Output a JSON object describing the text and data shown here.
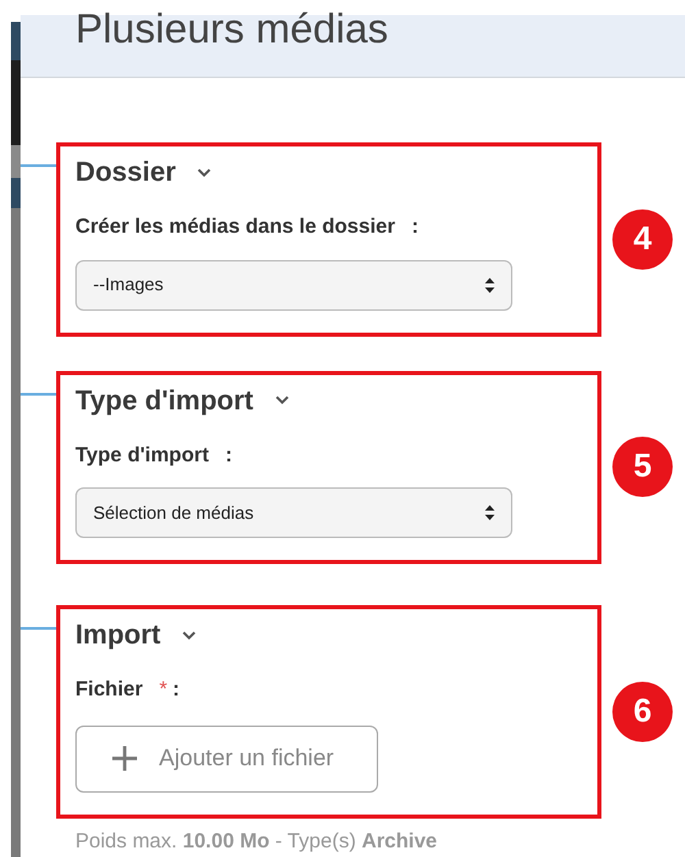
{
  "header": {
    "title": "Plusieurs médias"
  },
  "sections": [
    {
      "title": "Dossier",
      "expanded": true,
      "badge": "4",
      "field": {
        "kind": "select",
        "label": "Créer les médias dans le dossier",
        "colon": ":",
        "value": "--Images"
      }
    },
    {
      "title": "Type d'import",
      "expanded": true,
      "badge": "5",
      "field": {
        "kind": "select",
        "label": "Type d'import",
        "colon": ":",
        "value": "Sélection de médias"
      }
    },
    {
      "title": "Import",
      "expanded": true,
      "badge": "6",
      "field": {
        "kind": "file",
        "label": "Fichier",
        "required_mark": "*",
        "colon": ":",
        "button": "Ajouter un fichier"
      },
      "hint": "Poids max. **10.00 Mo** - Type(s) **Archive**"
    }
  ]
}
